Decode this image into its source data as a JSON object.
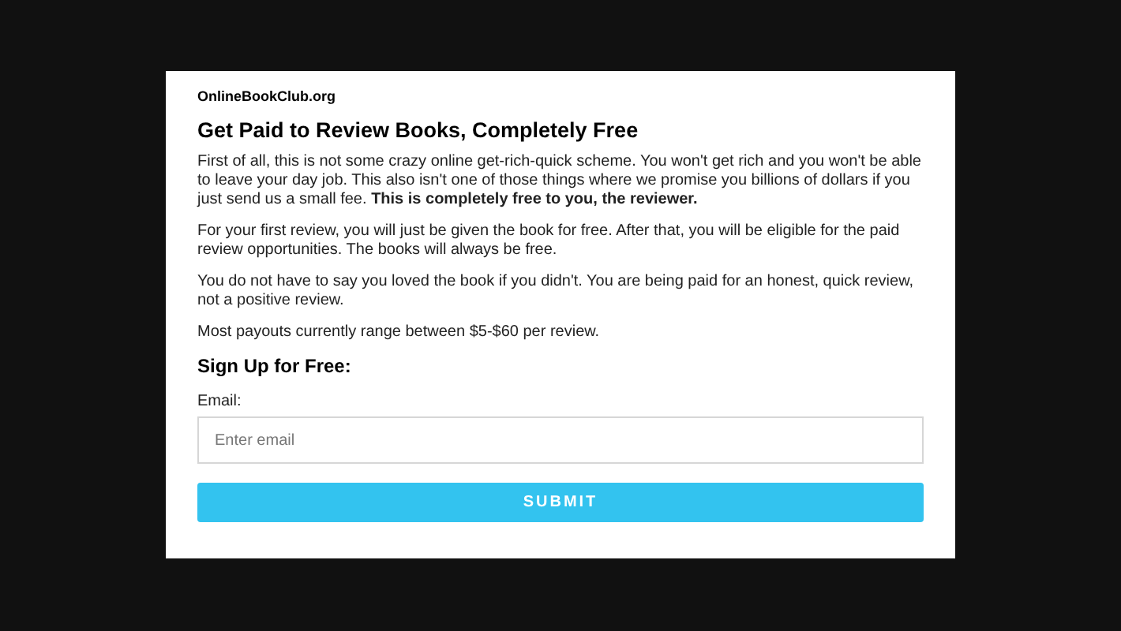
{
  "site": "OnlineBookClub.org",
  "title": "Get Paid to Review Books, Completely Free",
  "paragraphs": [
    "First of all, this is not some crazy online get-rich-quick scheme. You won't get rich and you won't be able to leave your day job. This also isn't one of those things where we promise you billions of dollars if you just send us a small fee. **This is completely free to you, the reviewer.**",
    "For your first review, you will just be given the book for free. After that, you will be eligible for the paid review opportunities. The books will always be free.",
    "You do not have to say you loved the book if you didn't. You are being paid for an honest, quick review, not a positive review.",
    "Most payouts currently range between $5-$60 per review."
  ],
  "signup": {
    "heading": "Sign Up for Free:",
    "label": "Email:",
    "placeholder": "Enter email",
    "button": "SUBMIT"
  }
}
